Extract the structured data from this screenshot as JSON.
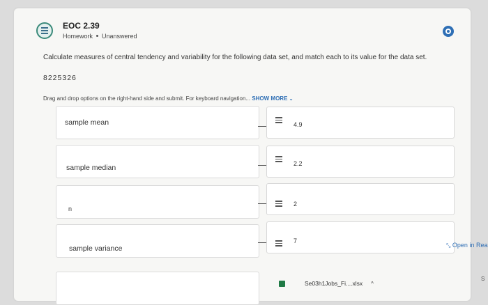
{
  "header": {
    "title": "EOC 2.39",
    "type": "Homework",
    "status": "Unanswered"
  },
  "question": {
    "prompt": "Calculate measures of central tendency and variability for the following data set, and match each to its value for the data set.",
    "dataset": "8225326",
    "instructions": "Drag and drop options on the right-hand side and submit. For keyboard navigation...",
    "show_more_label": "SHOW MORE"
  },
  "targets": [
    {
      "label": "sample mean"
    },
    {
      "label": "sample median"
    },
    {
      "label": "n"
    },
    {
      "label": "sample variance"
    }
  ],
  "options": [
    {
      "value": "4.9"
    },
    {
      "value": "2.2"
    },
    {
      "value": "2"
    },
    {
      "value": "7"
    }
  ],
  "side_link": {
    "label": "Open in Rea"
  },
  "download_bar": {
    "filename": "Se03h1Jobs_Fi....xlsx"
  },
  "corner_text": "S",
  "icons": {
    "assignment": "list-icon",
    "status": "circle-status-icon",
    "drag": "drag-handle-icon"
  },
  "colors": {
    "accent": "#2f6fb5",
    "icon_ring": "#3a8a7a"
  }
}
